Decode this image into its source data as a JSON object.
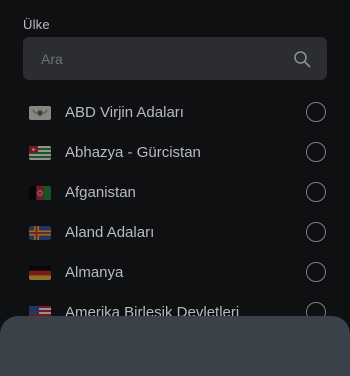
{
  "label": "Ülke",
  "search": {
    "placeholder": "Ara",
    "value": ""
  },
  "countries": [
    {
      "name": "ABD Virjin Adaları",
      "selected": false
    },
    {
      "name": "Abhazya - Gürcistan",
      "selected": false
    },
    {
      "name": "Afganistan",
      "selected": false
    },
    {
      "name": "Aland Adaları",
      "selected": false
    },
    {
      "name": "Almanya",
      "selected": false
    },
    {
      "name": "Amerika Birleşik Devletleri",
      "selected": false
    }
  ],
  "colors": {
    "background": "#0f1012",
    "search_bg": "#2b2d31",
    "sheet": "#3b4148"
  }
}
